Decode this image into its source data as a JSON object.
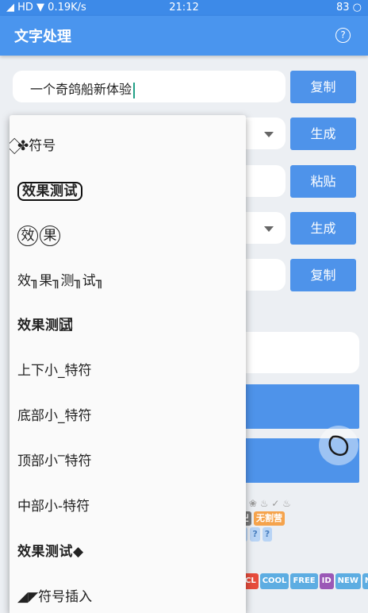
{
  "status_bar": {
    "left": "◢ HD ▼ 0.19K/s",
    "time": "21:12",
    "battery": "83"
  },
  "app_bar": {
    "title": "文字处理",
    "help_icon": "?"
  },
  "input": {
    "value": "一个奇鸽船新体验"
  },
  "buttons": {
    "copy_1": "复制",
    "generate_1": "生成",
    "paste": "粘贴",
    "generate_2": "生成",
    "copy_2": "复制"
  },
  "menu": {
    "items": [
      {
        "label": "⃟✤符号"
      },
      {
        "label": "效果测试"
      },
      {
        "label": "效果"
      },
      {
        "label": "效╖果╖测╖试╖"
      },
      {
        "label": "效果测试⃞"
      },
      {
        "label": "上下小_特符"
      },
      {
        "label": "底部小_特符"
      },
      {
        "label": "顶部小‾特符"
      },
      {
        "label": "中部小-特符"
      },
      {
        "label": "效果测试◆"
      },
      {
        "label": "◢◤符号插入"
      }
    ]
  },
  "stickers": {
    "row1": "无割营",
    "tags": [
      "CL",
      "COOL",
      "FREE",
      "ID",
      "NEW",
      "NG"
    ]
  },
  "colors": {
    "primary": "#4a95ee",
    "button": "#4e93ea",
    "cursor": "#21a086"
  }
}
